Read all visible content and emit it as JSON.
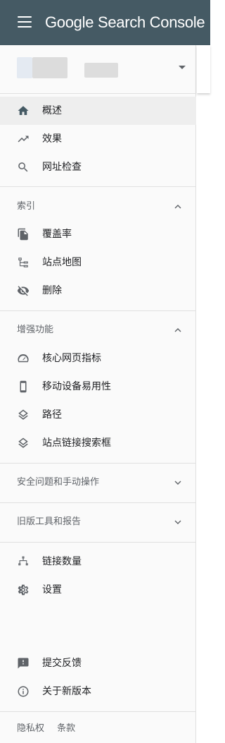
{
  "app": {
    "logo_google": "Google",
    "logo_product": "Search Console"
  },
  "nav": {
    "overview": "概述",
    "performance": "效果",
    "url_inspection": "网址检查"
  },
  "index": {
    "title": "索引",
    "coverage": "覆盖率",
    "sitemaps": "站点地图",
    "removals": "删除"
  },
  "enhancements": {
    "title": "增强功能",
    "core_web_vitals": "核心网页指标",
    "mobile_usability": "移动设备易用性",
    "breadcrumbs": "路径",
    "sitelinks_searchbox": "站点链接搜索框"
  },
  "security": {
    "title": "安全问题和手动操作"
  },
  "legacy": {
    "title": "旧版工具和报告"
  },
  "links": "链接数量",
  "settings": "设置",
  "feedback": "提交反馈",
  "about": "关于新版本",
  "footer": {
    "privacy": "隐私权",
    "terms": "条款"
  },
  "colors": {
    "header": "#455a64",
    "sidebar": "#fafafa",
    "active": "#eeeeee",
    "icon": "#5f6368",
    "home_icon": "#455a64"
  }
}
